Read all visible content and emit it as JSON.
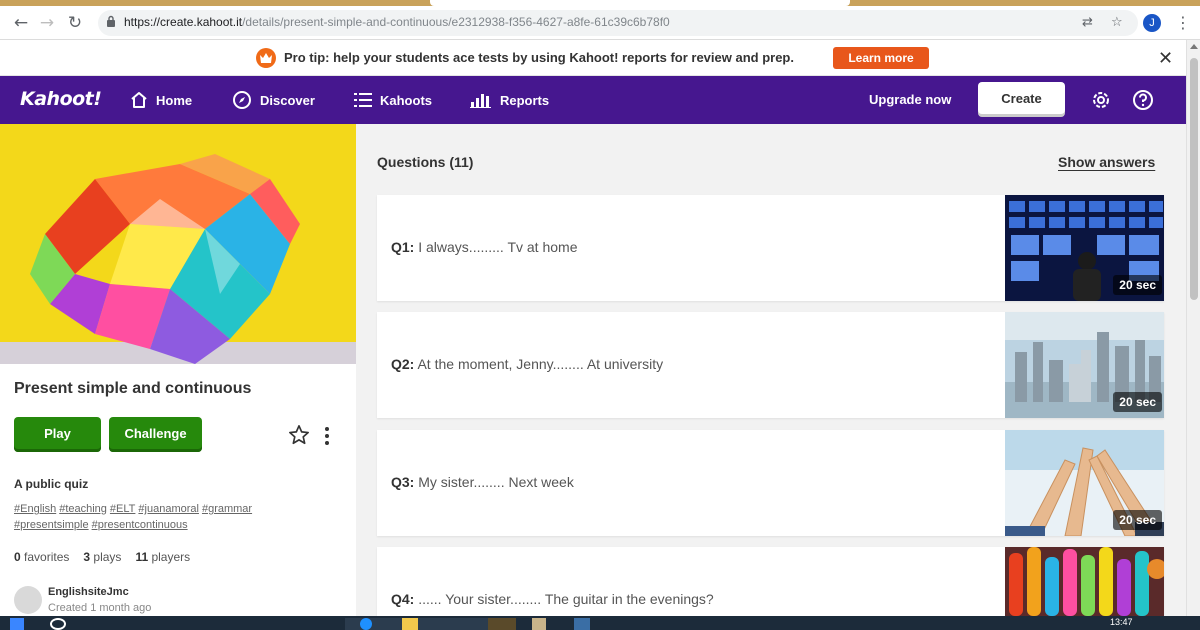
{
  "browser": {
    "url_host": "https://create.kahoot.it",
    "url_path": "/details/present-simple-and-continuous/e2312938-f356-4627-a8fe-61c39c6b78f0",
    "profile_initial": "J"
  },
  "protip": {
    "text": "Pro tip: help your students ace tests by using Kahoot! reports for review and prep.",
    "learn_more": "Learn more"
  },
  "nav": {
    "logo": "Kahoot!",
    "items": [
      {
        "label": "Home",
        "icon": "home-icon"
      },
      {
        "label": "Discover",
        "icon": "compass-icon"
      },
      {
        "label": "Kahoots",
        "icon": "list-icon"
      },
      {
        "label": "Reports",
        "icon": "bar-chart-icon"
      }
    ],
    "upgrade": "Upgrade now",
    "create": "Create"
  },
  "kahoot": {
    "title": "Present simple and continuous",
    "play": "Play",
    "challenge": "Challenge",
    "visibility": "A public quiz",
    "tags": [
      "#English",
      "#teaching",
      "#ELT",
      "#juanamoral",
      "#grammar",
      "#presentsimple",
      "#presentcontinuous"
    ],
    "favorites_count": "0",
    "favorites_label": "favorites",
    "plays_count": "3",
    "plays_label": "plays",
    "players_count": "11",
    "players_label": "players",
    "creator": "EnglishsiteJmc",
    "created": "Created 1 month ago"
  },
  "questions": {
    "header": "Questions (11)",
    "show_answers": "Show answers",
    "items": [
      {
        "num": "Q1:",
        "text": "I always......... Tv at home",
        "time": "20 sec",
        "image": "tv-screens-image"
      },
      {
        "num": "Q2:",
        "text": "At the moment, Jenny........ At university",
        "time": "20 sec",
        "image": "city-skyline-image"
      },
      {
        "num": "Q3:",
        "text": "My sister........ Next week",
        "time": "20 sec",
        "image": "high-five-image"
      },
      {
        "num": "Q4:",
        "text": "...... Your sister........ The guitar in the evenings?",
        "time": "",
        "image": "guitars-image"
      }
    ]
  },
  "taskbar": {
    "clock": "13:47"
  },
  "colors": {
    "kahoot_purple": "#46178f",
    "play_green": "#26890c",
    "learn_orange": "#e8571b"
  }
}
